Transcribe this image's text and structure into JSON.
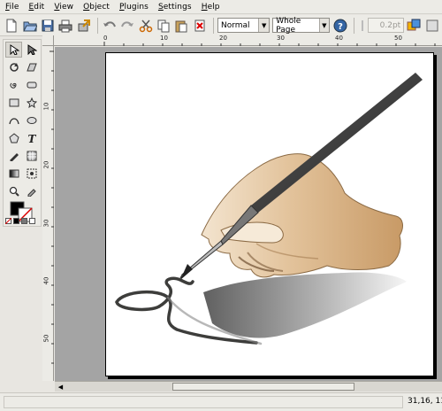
{
  "menu": [
    "File",
    "Edit",
    "View",
    "Object",
    "Plugins",
    "Settings",
    "Help"
  ],
  "toolbar": {
    "mode_select": "Normal",
    "zoom_select": "Whole Page",
    "line_width": "0.2pt"
  },
  "ruler": {
    "top_labels": [
      "0",
      "10",
      "20",
      "30",
      "40",
      "50"
    ],
    "left_labels": [
      "10",
      "20",
      "30",
      "40",
      "50"
    ]
  },
  "status": {
    "message": "",
    "coords": "31,16, 11"
  },
  "colors": {
    "accent": "#3465a4",
    "canvas_bg": "#a4a4a4",
    "pen_dark": "#3d3d3b",
    "skin": "#d9b88e"
  }
}
